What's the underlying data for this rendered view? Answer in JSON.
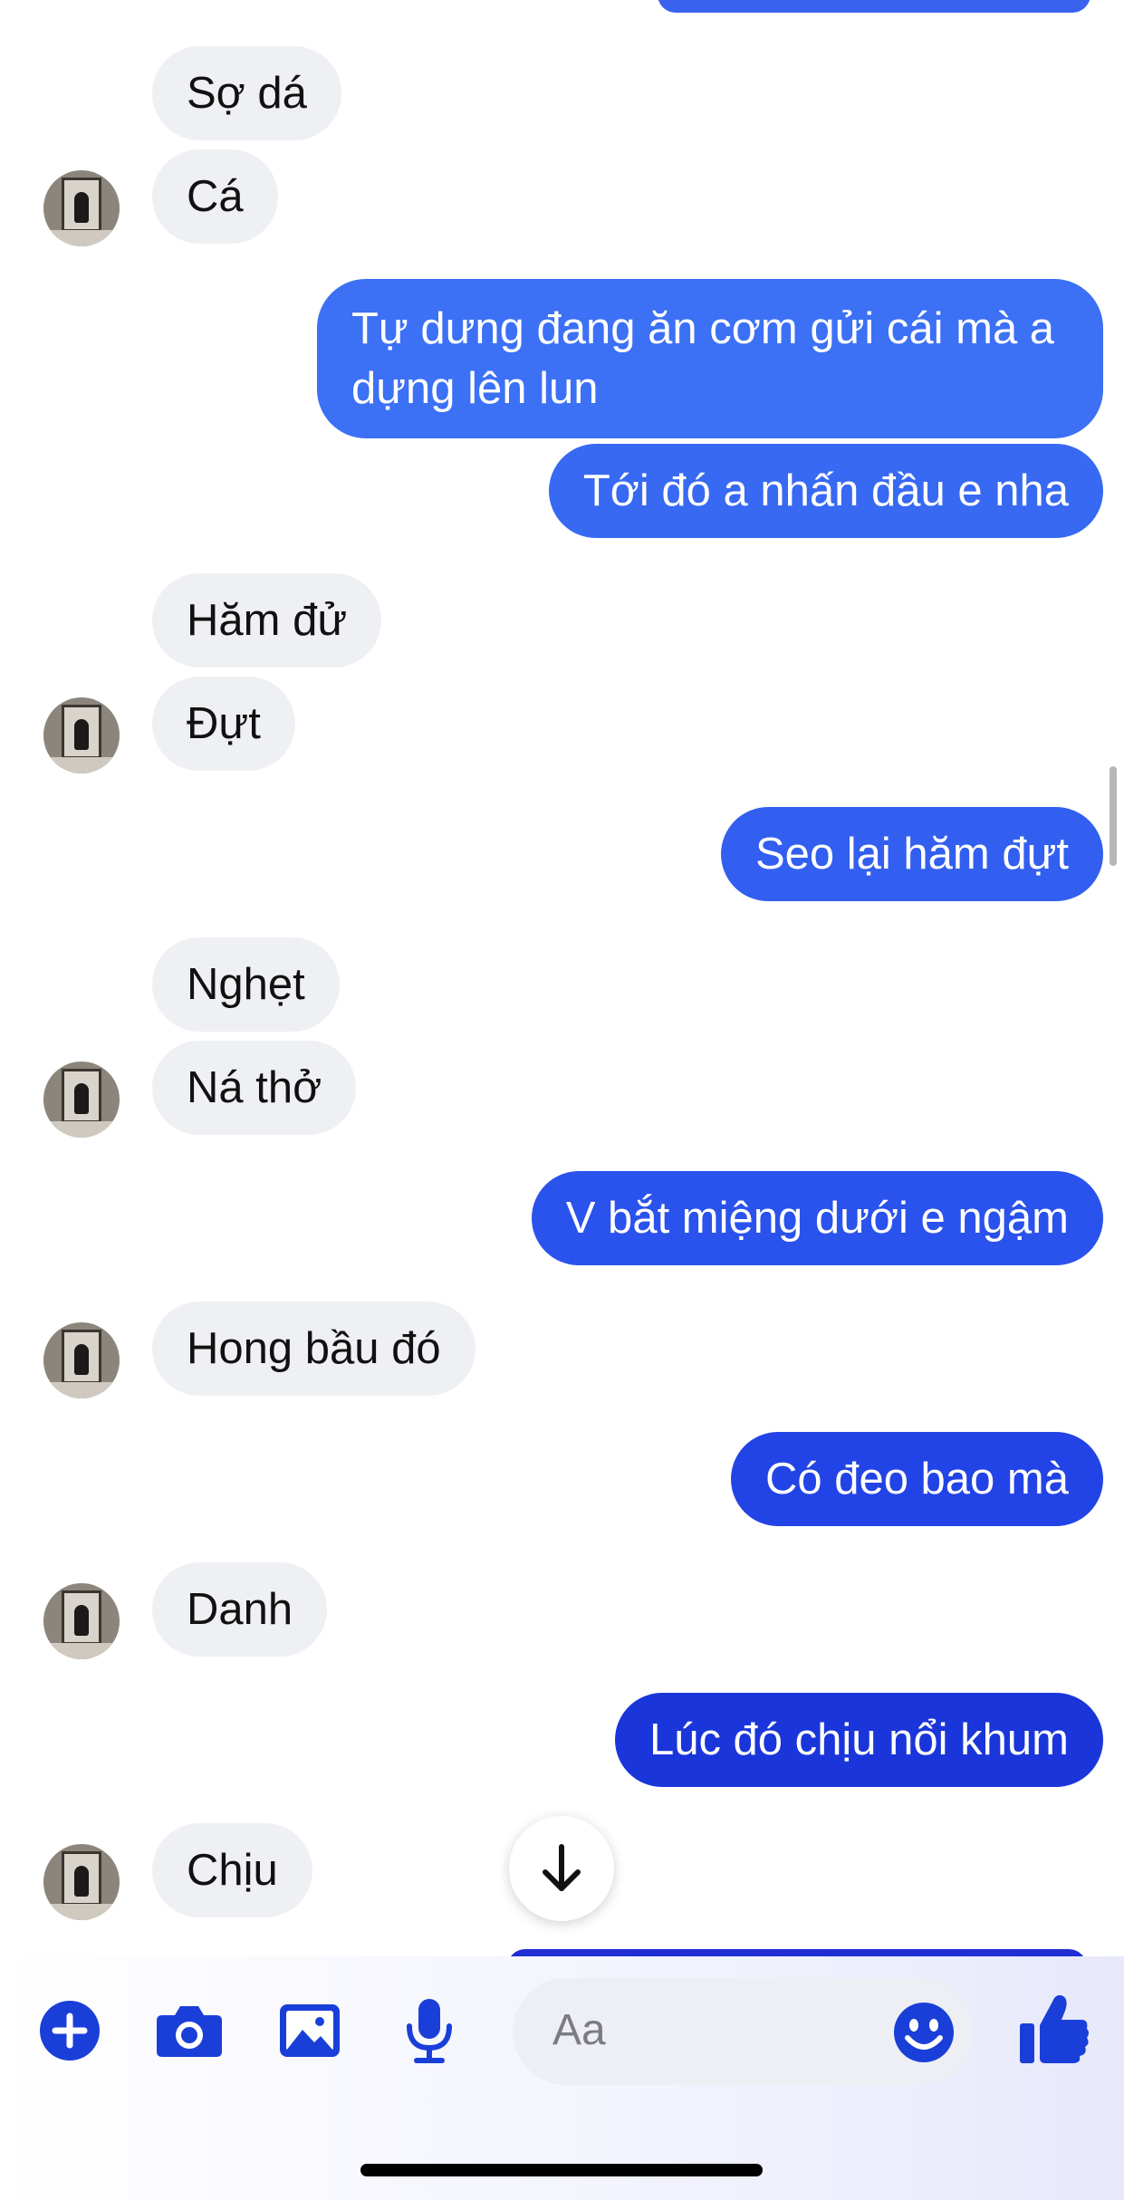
{
  "colors": {
    "incoming_bubble": "#eff0f3",
    "outgoing_top": "#3b6ff4",
    "outgoing_bottom": "#1a2fd6",
    "accent": "#1a3fd8"
  },
  "messages": [
    {
      "side": "in",
      "text": "Sợ dá"
    },
    {
      "side": "in",
      "text": "Cá"
    },
    {
      "side": "out",
      "text": "Tự dưng đang ăn cơm gửi cái mà a dựng lên lun"
    },
    {
      "side": "out",
      "text": "Tới đó a nhấn đầu e nha"
    },
    {
      "side": "in",
      "text": "Hăm đử"
    },
    {
      "side": "in",
      "text": "Đựt"
    },
    {
      "side": "out",
      "text": "Seo lại hăm đựt"
    },
    {
      "side": "in",
      "text": "Nghẹt"
    },
    {
      "side": "in",
      "text": "Ná thở"
    },
    {
      "side": "out",
      "text": "V bắt miệng dưới e ngậm"
    },
    {
      "side": "in",
      "text": "Hong bầu đó"
    },
    {
      "side": "out",
      "text": "Có đeo bao mà"
    },
    {
      "side": "in",
      "text": "Danh"
    },
    {
      "side": "out",
      "text": "Lúc đó chịu nổi khum"
    },
    {
      "side": "in",
      "text": "Chịu"
    }
  ],
  "composer": {
    "placeholder": "Aa",
    "tools": [
      "plus-icon",
      "camera-icon",
      "image-icon",
      "microphone-icon"
    ],
    "emoji_icon": "smiley-icon",
    "send_icon": "thumbs-up-icon"
  },
  "scroll_button_icon": "arrow-down-icon"
}
